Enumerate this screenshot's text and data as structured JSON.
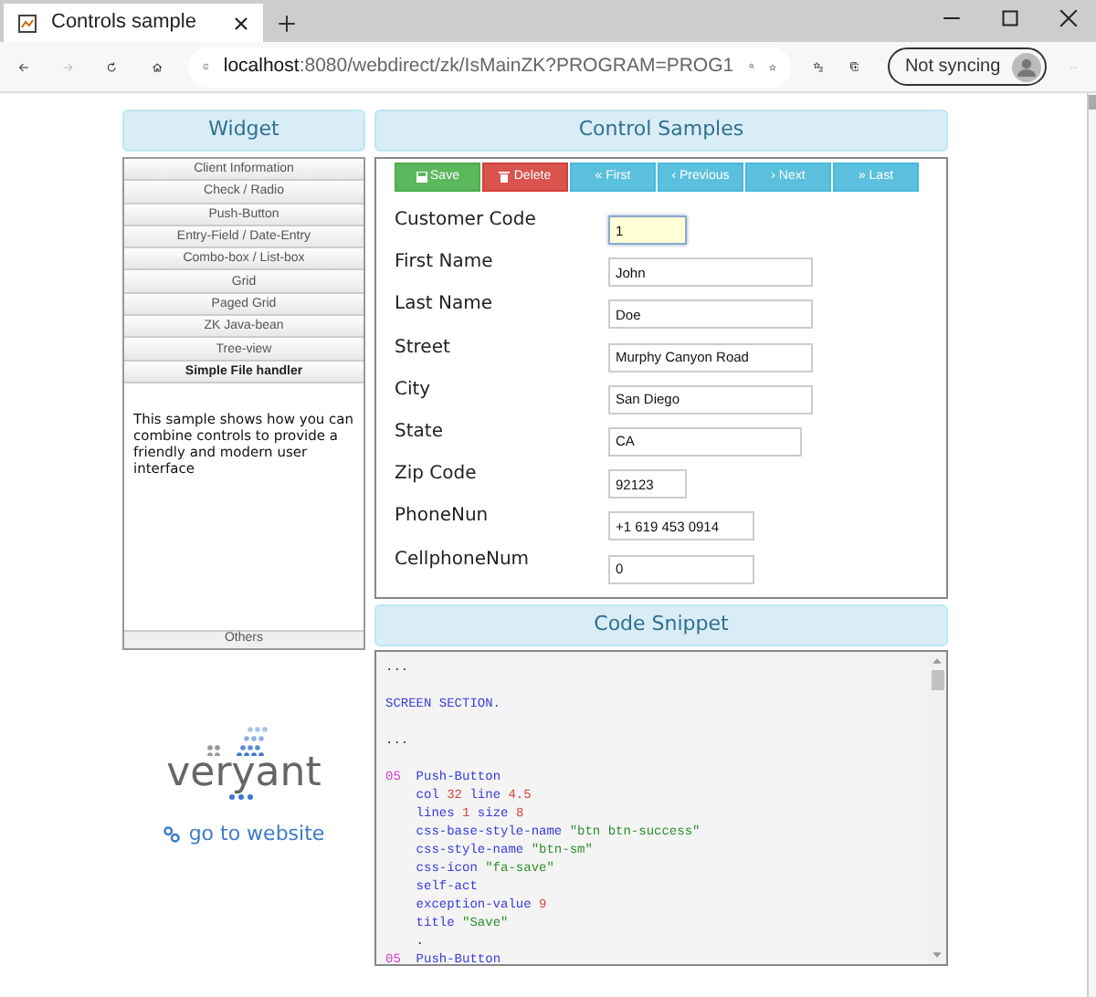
{
  "browser": {
    "tab_title": "Controls sample",
    "url_host": "localhost",
    "url_rest": ":8080/webdirect/zk/IsMainZK?PROGRAM=PROG1",
    "sync_label": "Not syncing",
    "forward_disabled": true
  },
  "widget": {
    "title": "Widget",
    "items": [
      {
        "label": "Client Information",
        "selected": false
      },
      {
        "label": "Check / Radio",
        "selected": false
      },
      {
        "label": "Push-Button",
        "selected": false
      },
      {
        "label": "Entry-Field / Date-Entry",
        "selected": false
      },
      {
        "label": "Combo-box / List-box",
        "selected": false
      },
      {
        "label": "Grid",
        "selected": false
      },
      {
        "label": "Paged Grid",
        "selected": false
      },
      {
        "label": "ZK Java-bean",
        "selected": false
      },
      {
        "label": "Tree-view",
        "selected": false
      },
      {
        "label": "Simple File handler",
        "selected": true
      }
    ],
    "description": "This sample shows how you can combine controls to provide a friendly and modern user interface",
    "footer_item": "Others"
  },
  "logo": {
    "text": "veryant"
  },
  "website_link": "go to website",
  "control_samples": {
    "title": "Control Samples",
    "buttons": [
      {
        "label": "Save",
        "kind": "success"
      },
      {
        "label": "Delete",
        "kind": "danger"
      },
      {
        "label": "« First",
        "kind": "info"
      },
      {
        "label": "‹ Previous",
        "kind": "info"
      },
      {
        "label": "› Next",
        "kind": "info"
      },
      {
        "label": "» Last",
        "kind": "info"
      }
    ],
    "fields": [
      {
        "label": "Customer Code",
        "value": "1",
        "focused": true
      },
      {
        "label": "First Name",
        "value": "John",
        "focused": false
      },
      {
        "label": "Last Name",
        "value": "Doe",
        "focused": false
      },
      {
        "label": "Street",
        "value": "Murphy Canyon Road",
        "focused": false
      },
      {
        "label": "City",
        "value": "San Diego",
        "focused": false
      },
      {
        "label": "State",
        "value": "CA",
        "focused": false
      },
      {
        "label": "Zip Code",
        "value": "92123",
        "focused": false
      },
      {
        "label": "PhoneNun",
        "value": "+1 619 453 0914",
        "focused": false
      },
      {
        "label": "CellphoneNum",
        "value": "0",
        "focused": false
      }
    ]
  },
  "code_snippet": {
    "title": "Code Snippet",
    "blocks": [
      [
        {
          "segments": [
            {
              "text": "...",
              "kind": "plain"
            }
          ]
        }
      ],
      [
        {
          "segments": [
            {
              "text": "SCREEN SECTION.",
              "kind": "keyword"
            }
          ]
        }
      ],
      [
        {
          "segments": [
            {
              "text": "...",
              "kind": "plain"
            }
          ]
        }
      ],
      [
        {
          "segments": [
            {
              "text": "05",
              "kind": "level"
            },
            {
              "text": "  Push-Button",
              "kind": "keyword"
            }
          ]
        },
        {
          "segments": [
            {
              "text": "    col ",
              "kind": "keyword"
            },
            {
              "text": "32",
              "kind": "number"
            },
            {
              "text": " line ",
              "kind": "keyword"
            },
            {
              "text": "4.5",
              "kind": "number"
            }
          ]
        },
        {
          "segments": [
            {
              "text": "    lines ",
              "kind": "keyword"
            },
            {
              "text": "1",
              "kind": "number"
            },
            {
              "text": " size ",
              "kind": "keyword"
            },
            {
              "text": "8",
              "kind": "number"
            }
          ]
        },
        {
          "segments": [
            {
              "text": "    css-base-style-name ",
              "kind": "keyword"
            },
            {
              "text": "\"btn btn-success\"",
              "kind": "string"
            }
          ]
        },
        {
          "segments": [
            {
              "text": "    css-style-name ",
              "kind": "keyword"
            },
            {
              "text": "\"btn-sm\"",
              "kind": "string"
            }
          ]
        },
        {
          "segments": [
            {
              "text": "    css-icon ",
              "kind": "keyword"
            },
            {
              "text": "\"fa-save\"",
              "kind": "string"
            }
          ]
        },
        {
          "segments": [
            {
              "text": "    self-act",
              "kind": "keyword"
            }
          ]
        },
        {
          "segments": [
            {
              "text": "    exception-value ",
              "kind": "keyword"
            },
            {
              "text": "9",
              "kind": "number"
            }
          ]
        },
        {
          "segments": [
            {
              "text": "    title ",
              "kind": "keyword"
            },
            {
              "text": "\"Save\"",
              "kind": "string"
            }
          ]
        },
        {
          "segments": [
            {
              "text": "    .",
              "kind": "plain"
            }
          ]
        },
        {
          "segments": [
            {
              "text": "05",
              "kind": "level"
            },
            {
              "text": "  Push-Button",
              "kind": "keyword"
            }
          ]
        }
      ]
    ]
  }
}
